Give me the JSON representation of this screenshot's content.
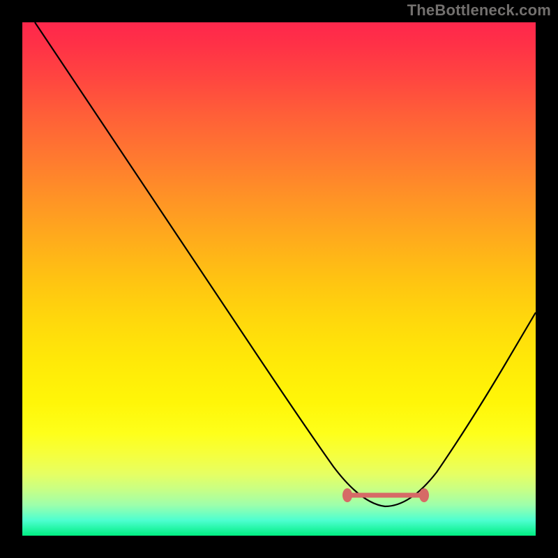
{
  "watermark": "TheBottleneck.com",
  "chart_data": {
    "type": "line",
    "title": "",
    "xlabel": "",
    "ylabel": "",
    "xlim": [
      0,
      100
    ],
    "ylim": [
      0,
      100
    ],
    "grid": false,
    "series": [
      {
        "name": "bottleneck-curve",
        "x": [
          2,
          10,
          20,
          30,
          40,
          50,
          57,
          62,
          66,
          70,
          74,
          78,
          82,
          86,
          90,
          94,
          98,
          100
        ],
        "y": [
          100,
          88,
          73,
          58,
          43,
          28,
          17,
          10,
          6,
          4,
          4,
          6,
          11,
          18,
          27,
          37,
          48,
          54
        ]
      }
    ],
    "marker": {
      "name": "optimal-range",
      "x_start": 63,
      "x_end": 79,
      "y": 8
    },
    "background_gradient": {
      "top": "#ff274c",
      "mid": "#ffe908",
      "bottom": "#00ee82"
    }
  }
}
